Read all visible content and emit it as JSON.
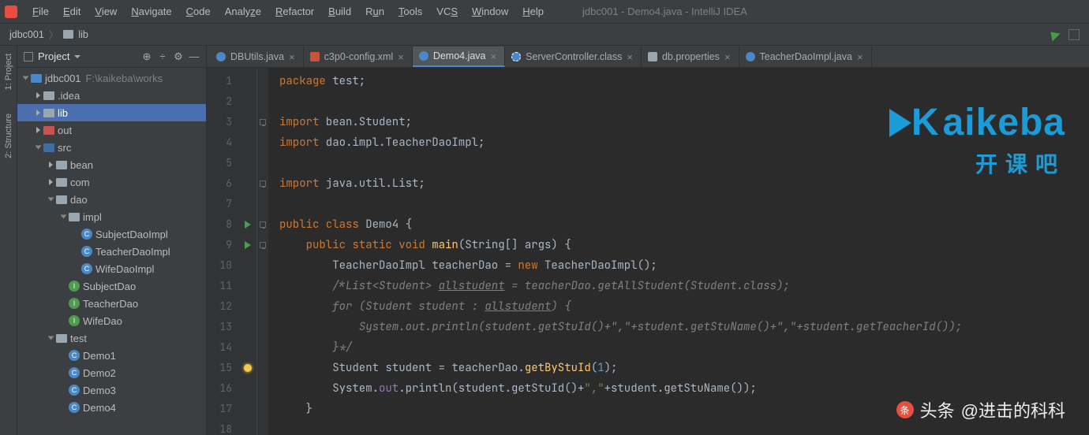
{
  "menubar": {
    "items": [
      "File",
      "Edit",
      "View",
      "Navigate",
      "Code",
      "Analyze",
      "Refactor",
      "Build",
      "Run",
      "Tools",
      "VCS",
      "Window",
      "Help"
    ],
    "title": "jdbc001 - Demo4.java - IntelliJ IDEA"
  },
  "breadcrumb": {
    "project": "jdbc001",
    "folder": "lib"
  },
  "project_panel": {
    "title": "Project"
  },
  "tree": [
    {
      "depth": 0,
      "arrow": "open",
      "icon": "folder-blue",
      "label": "jdbc001",
      "path": "F:\\kaikeba\\works",
      "selected": false
    },
    {
      "depth": 1,
      "arrow": "closed",
      "icon": "folder-grey",
      "label": ".idea"
    },
    {
      "depth": 1,
      "arrow": "closed",
      "icon": "folder-grey",
      "label": "lib",
      "selected": true
    },
    {
      "depth": 1,
      "arrow": "closed",
      "icon": "folder-orange",
      "label": "out"
    },
    {
      "depth": 1,
      "arrow": "open",
      "icon": "folder-src",
      "label": "src"
    },
    {
      "depth": 2,
      "arrow": "closed",
      "icon": "folder-grey",
      "label": "bean"
    },
    {
      "depth": 2,
      "arrow": "closed",
      "icon": "folder-grey",
      "label": "com"
    },
    {
      "depth": 2,
      "arrow": "open",
      "icon": "folder-grey",
      "label": "dao"
    },
    {
      "depth": 3,
      "arrow": "open",
      "icon": "folder-grey",
      "label": "impl"
    },
    {
      "depth": 4,
      "arrow": "none",
      "icon": "class",
      "label": "SubjectDaoImpl"
    },
    {
      "depth": 4,
      "arrow": "none",
      "icon": "class",
      "label": "TeacherDaoImpl"
    },
    {
      "depth": 4,
      "arrow": "none",
      "icon": "class",
      "label": "WifeDaoImpl"
    },
    {
      "depth": 3,
      "arrow": "none",
      "icon": "interface",
      "label": "SubjectDao"
    },
    {
      "depth": 3,
      "arrow": "none",
      "icon": "interface",
      "label": "TeacherDao"
    },
    {
      "depth": 3,
      "arrow": "none",
      "icon": "interface",
      "label": "WifeDao"
    },
    {
      "depth": 2,
      "arrow": "open",
      "icon": "folder-grey",
      "label": "test"
    },
    {
      "depth": 3,
      "arrow": "none",
      "icon": "class",
      "label": "Demo1"
    },
    {
      "depth": 3,
      "arrow": "none",
      "icon": "class",
      "label": "Demo2"
    },
    {
      "depth": 3,
      "arrow": "none",
      "icon": "class",
      "label": "Demo3"
    },
    {
      "depth": 3,
      "arrow": "none",
      "icon": "class",
      "label": "Demo4"
    }
  ],
  "tabs": [
    {
      "label": "DBUtils.java",
      "icon": "java"
    },
    {
      "label": "c3p0-config.xml",
      "icon": "xml"
    },
    {
      "label": "Demo4.java",
      "icon": "java",
      "active": true
    },
    {
      "label": "ServerController.class",
      "icon": "class"
    },
    {
      "label": "db.properties",
      "icon": "prop"
    },
    {
      "label": "TeacherDaoImpl.java",
      "icon": "java"
    }
  ],
  "code_lines": [
    1,
    2,
    3,
    4,
    5,
    6,
    7,
    8,
    9,
    10,
    11,
    12,
    13,
    14,
    15,
    16,
    17,
    18
  ],
  "gutter_markers": {
    "8": "run",
    "9": "run",
    "15": "bulb"
  },
  "code": {
    "l1": "package test;",
    "l3a": "import",
    "l3b": " bean.Student;",
    "l4a": "import",
    "l4b": " dao.impl.TeacherDaoImpl;",
    "l6a": "import",
    "l6b": " java.util.List;",
    "l8": "public class Demo4 {",
    "l9": "    public static void main(String[] args) {",
    "l10": "        TeacherDaoImpl teacherDao = new TeacherDaoImpl();",
    "l11": "        /*List<Student> allstudent = teacherDao.getAllStudent(Student.class);",
    "l12": "        for (Student student : allstudent) {",
    "l13": "            System.out.println(student.getStuId()+\",\"+student.getStuName()+\",\"+student.getTeacherId());",
    "l14": "        }*/",
    "l15": "        Student student = teacherDao.getByStuId(1);",
    "l16": "        System.out.println(student.getStuId()+\",\"+student.getStuName());",
    "l17": "    }"
  },
  "watermark": {
    "brand": "aikeba",
    "brand_k": "K",
    "sub": "开课吧",
    "footer_label": "头条",
    "footer_user": "@进击的科科"
  },
  "left_tools": {
    "project": "1: Project",
    "structure": "2: Structure"
  }
}
